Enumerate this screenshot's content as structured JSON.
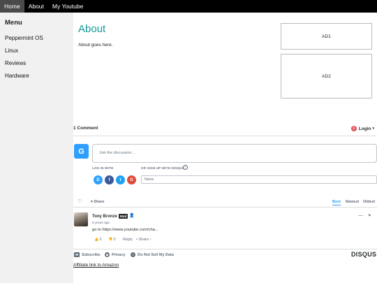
{
  "nav": {
    "items": [
      {
        "label": "Home",
        "active": true
      },
      {
        "label": "About",
        "active": false
      },
      {
        "label": "My Youtube",
        "active": false
      }
    ]
  },
  "sidebar": {
    "title": "Menu",
    "items": [
      {
        "label": "Peppermint OS"
      },
      {
        "label": "Linux"
      },
      {
        "label": "Reviews"
      },
      {
        "label": "Hardware"
      }
    ]
  },
  "main": {
    "title": "About",
    "body": "About goes here."
  },
  "ads": {
    "ad1": "AD1",
    "ad2": "AD2"
  },
  "disqus": {
    "comment_count": "1 Comment",
    "login_label": "Login",
    "login_badge": "1",
    "avatar_letter": "G",
    "discussion_placeholder": "Join the discussion…",
    "log_in_with": "LOG IN WITH",
    "or_sign_up": "OR SIGN UP WITH DISQUS",
    "help_glyph": "?",
    "name_placeholder": "Name",
    "social": [
      "D",
      "f",
      "t",
      "G"
    ],
    "share_label": "Share",
    "sort": {
      "best": "Best",
      "newest": "Newest",
      "oldest": "Oldest"
    },
    "comment": {
      "author": "Tony Bronze",
      "badge": "Mod",
      "time": "6 years ago",
      "text": "go to https://www.youtube.com/cha...",
      "upvotes": "0",
      "downvotes": "0",
      "reply_label": "Reply",
      "share_label": "Share ›"
    },
    "footer": {
      "subscribe": "Subscribe",
      "privacy": "Privacy",
      "do_not_sell": "Do Not Sell My Data",
      "logo": "DISQUS"
    }
  },
  "affiliate": "Affiliate link to Amazon",
  "colors": {
    "accent": "#139a9a",
    "disqus_blue": "#2e9fff",
    "login_red": "#e25560"
  }
}
